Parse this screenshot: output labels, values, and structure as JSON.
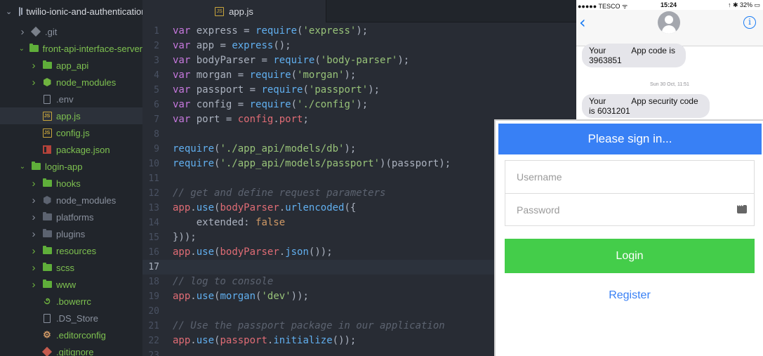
{
  "tree": {
    "root": "twilio-ionic-and-authentication",
    "rows": [
      {
        "label": ".git",
        "depth": 1,
        "chevron": "right",
        "icon": "git-icon",
        "color": "grey"
      },
      {
        "label": "front-api-interface-server",
        "depth": 1,
        "chevron": "down",
        "icon": "folder-icon",
        "color": "green"
      },
      {
        "label": "app_api",
        "depth": 2,
        "chevron": "right",
        "icon": "folder-icon",
        "color": "green"
      },
      {
        "label": "node_modules",
        "depth": 2,
        "chevron": "right",
        "icon": "node-icon",
        "color": "green"
      },
      {
        "label": ".env",
        "depth": 2,
        "chevron": "",
        "icon": "file-icon",
        "color": "grey"
      },
      {
        "label": "app.js",
        "depth": 2,
        "chevron": "",
        "icon": "js-file-icon",
        "color": "green",
        "selected": true
      },
      {
        "label": "config.js",
        "depth": 2,
        "chevron": "",
        "icon": "js-file-icon",
        "color": "green"
      },
      {
        "label": "package.json",
        "depth": 2,
        "chevron": "",
        "icon": "npm-icon",
        "color": "green"
      },
      {
        "label": "login-app",
        "depth": 1,
        "chevron": "down",
        "icon": "folder-icon",
        "color": "green"
      },
      {
        "label": "hooks",
        "depth": 2,
        "chevron": "right",
        "icon": "folder-icon",
        "color": "green"
      },
      {
        "label": "node_modules",
        "depth": 2,
        "chevron": "right",
        "icon": "node-icon-dim",
        "color": "grey"
      },
      {
        "label": "platforms",
        "depth": 2,
        "chevron": "right",
        "icon": "folder-icon-dim",
        "color": "grey"
      },
      {
        "label": "plugins",
        "depth": 2,
        "chevron": "right",
        "icon": "folder-icon-dim",
        "color": "grey"
      },
      {
        "label": "resources",
        "depth": 2,
        "chevron": "right",
        "icon": "folder-icon",
        "color": "green"
      },
      {
        "label": "scss",
        "depth": 2,
        "chevron": "right",
        "icon": "folder-icon",
        "color": "green"
      },
      {
        "label": "www",
        "depth": 2,
        "chevron": "right",
        "icon": "folder-icon",
        "color": "green"
      },
      {
        "label": ".bowerrc",
        "depth": 2,
        "chevron": "",
        "icon": "bower-icon",
        "color": "green"
      },
      {
        "label": ".DS_Store",
        "depth": 2,
        "chevron": "",
        "icon": "file-icon",
        "color": "grey"
      },
      {
        "label": ".editorconfig",
        "depth": 2,
        "chevron": "",
        "icon": "gear-icon",
        "color": "green"
      },
      {
        "label": ".gitignore",
        "depth": 2,
        "chevron": "",
        "icon": "git-icon-red",
        "color": "green"
      }
    ]
  },
  "tab": {
    "label": "app.js",
    "icon": "js-file-icon"
  },
  "editor": {
    "cursor_line": 17,
    "lines": [
      [
        [
          "kw",
          "var"
        ],
        [
          "pl",
          " express = "
        ],
        [
          "fn",
          "require"
        ],
        [
          "pl",
          "("
        ],
        [
          "str",
          "'express'"
        ],
        [
          "pl",
          ");"
        ]
      ],
      [
        [
          "kw",
          "var"
        ],
        [
          "pl",
          " app = "
        ],
        [
          "fn",
          "express"
        ],
        [
          "pl",
          "();"
        ]
      ],
      [
        [
          "kw",
          "var"
        ],
        [
          "pl",
          " bodyParser = "
        ],
        [
          "fn",
          "require"
        ],
        [
          "pl",
          "("
        ],
        [
          "str",
          "'body-parser'"
        ],
        [
          "pl",
          ");"
        ]
      ],
      [
        [
          "kw",
          "var"
        ],
        [
          "pl",
          " morgan = "
        ],
        [
          "fn",
          "require"
        ],
        [
          "pl",
          "("
        ],
        [
          "str",
          "'morgan'"
        ],
        [
          "pl",
          ");"
        ]
      ],
      [
        [
          "kw",
          "var"
        ],
        [
          "pl",
          " passport = "
        ],
        [
          "fn",
          "require"
        ],
        [
          "pl",
          "("
        ],
        [
          "str",
          "'passport'"
        ],
        [
          "pl",
          ");"
        ]
      ],
      [
        [
          "kw",
          "var"
        ],
        [
          "pl",
          " config = "
        ],
        [
          "fn",
          "require"
        ],
        [
          "pl",
          "("
        ],
        [
          "str",
          "'./config'"
        ],
        [
          "pl",
          ");"
        ]
      ],
      [
        [
          "kw",
          "var"
        ],
        [
          "pl",
          " port = "
        ],
        [
          "var",
          "config"
        ],
        [
          "pl",
          "."
        ],
        [
          "var",
          "port"
        ],
        [
          "pl",
          ";"
        ]
      ],
      [],
      [
        [
          "fn",
          "require"
        ],
        [
          "pl",
          "("
        ],
        [
          "str",
          "'./app_api/models/db'"
        ],
        [
          "pl",
          ");"
        ]
      ],
      [
        [
          "fn",
          "require"
        ],
        [
          "pl",
          "("
        ],
        [
          "str",
          "'./app_api/models/passport'"
        ],
        [
          "pl",
          ")(passport);"
        ]
      ],
      [],
      [
        [
          "cm",
          "// get and define request parameters"
        ]
      ],
      [
        [
          "var",
          "app"
        ],
        [
          "pl",
          "."
        ],
        [
          "fn",
          "use"
        ],
        [
          "pl",
          "("
        ],
        [
          "var",
          "bodyParser"
        ],
        [
          "pl",
          "."
        ],
        [
          "fn",
          "urlencoded"
        ],
        [
          "pl",
          "({"
        ]
      ],
      [
        [
          "pl",
          "    extended: "
        ],
        [
          "bool",
          "false"
        ]
      ],
      [
        [
          "pl",
          "}));"
        ]
      ],
      [
        [
          "var",
          "app"
        ],
        [
          "pl",
          "."
        ],
        [
          "fn",
          "use"
        ],
        [
          "pl",
          "("
        ],
        [
          "var",
          "bodyParser"
        ],
        [
          "pl",
          "."
        ],
        [
          "fn",
          "json"
        ],
        [
          "pl",
          "());"
        ]
      ],
      [],
      [
        [
          "cm",
          "// log to console"
        ]
      ],
      [
        [
          "var",
          "app"
        ],
        [
          "pl",
          "."
        ],
        [
          "fn",
          "use"
        ],
        [
          "pl",
          "("
        ],
        [
          "fn",
          "morgan"
        ],
        [
          "pl",
          "("
        ],
        [
          "str",
          "'dev'"
        ],
        [
          "pl",
          "));"
        ]
      ],
      [],
      [
        [
          "cm",
          "// Use the passport package in our application"
        ]
      ],
      [
        [
          "var",
          "app"
        ],
        [
          "pl",
          "."
        ],
        [
          "fn",
          "use"
        ],
        [
          "pl",
          "("
        ],
        [
          "var",
          "passport"
        ],
        [
          "pl",
          "."
        ],
        [
          "fn",
          "initialize"
        ],
        [
          "pl",
          "());"
        ]
      ],
      []
    ]
  },
  "sms": {
    "status": {
      "carrier": "●●●●● TESCO ᯤ",
      "time": "15:24",
      "battery": "↑ ✱ 32% ▭"
    },
    "back_glyph": "‹",
    "info_glyph": "i",
    "message1_a": "Your",
    "message1_b": "App code is",
    "message1_c": "3963851",
    "date": "Sun 30 Oct, 11:51",
    "message2_a": "Your",
    "message2_b": "App security code",
    "message2_c": "is 6031201"
  },
  "login": {
    "header": "Please sign in...",
    "username_placeholder": "Username",
    "password_placeholder": "Password",
    "login_button": "Login",
    "register_link": "Register"
  },
  "colors": {
    "editor_bg": "#282c34",
    "sidebar_bg": "#21252b",
    "ionic_blue": "#3880f5",
    "login_green": "#44cd4a",
    "ios_blue": "#1b7cf3"
  }
}
